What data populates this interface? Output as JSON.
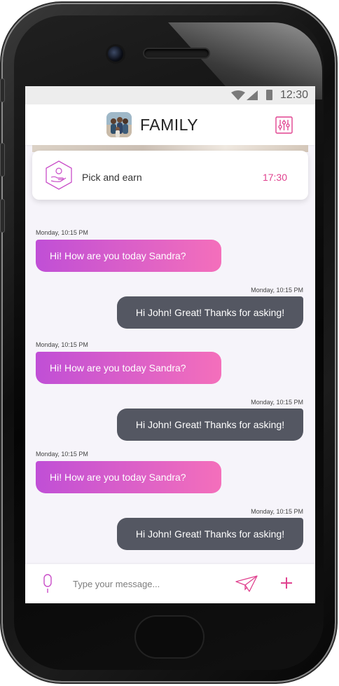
{
  "status_bar": {
    "time": "12:30"
  },
  "header": {
    "title": "FAMILY"
  },
  "task_card": {
    "label": "Pick and earn",
    "time": "17:30"
  },
  "messages": [
    {
      "direction": "in",
      "timestamp": "Monday, 10:15 PM",
      "text": "Hi! How are you today Sandra?"
    },
    {
      "direction": "out",
      "timestamp": "Monday, 10:15 PM",
      "text": "Hi John! Great! Thanks for asking!"
    },
    {
      "direction": "in",
      "timestamp": "Monday, 10:15 PM",
      "text": "Hi! How are you today Sandra?"
    },
    {
      "direction": "out",
      "timestamp": "Monday, 10:15 PM",
      "text": "Hi John! Great! Thanks for asking!"
    },
    {
      "direction": "in",
      "timestamp": "Monday, 10:15 PM",
      "text": "Hi! How are you today Sandra?"
    },
    {
      "direction": "out",
      "timestamp": "Monday, 10:15 PM",
      "text": "Hi John! Great! Thanks for asking!"
    }
  ],
  "composer": {
    "placeholder": "Type your message..."
  },
  "colors": {
    "accent": "#e0428f",
    "incoming_start": "#c04fd6",
    "incoming_end": "#f46fbb",
    "outgoing": "#545762"
  },
  "icons": [
    "wifi-icon",
    "signal-icon",
    "battery-icon",
    "settings-sliders-icon",
    "hand-coin-icon",
    "microphone-icon",
    "send-icon",
    "plus-icon"
  ]
}
